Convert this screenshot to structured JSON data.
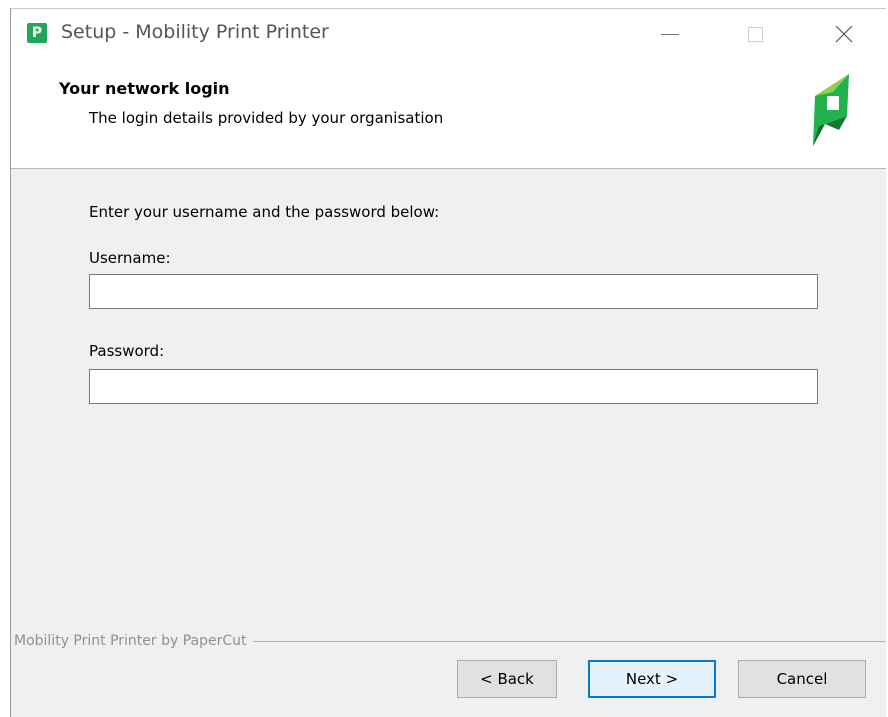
{
  "window": {
    "title": "Setup - Mobility Print Printer",
    "app_icon_letter": "P",
    "controls": {
      "minimize": "minimize",
      "maximize": "maximize",
      "close": "close"
    }
  },
  "header": {
    "title": "Your network login",
    "subtitle": "The login details provided by your organisation",
    "logo": "papercut-logo"
  },
  "form": {
    "instruction": "Enter your username and the password below:",
    "username_label": "Username:",
    "username_value": "",
    "password_label": "Password:",
    "password_value": ""
  },
  "footer": {
    "group_label": "Mobility Print Printer by PaperCut",
    "buttons": {
      "back": "< Back",
      "next": "Next >",
      "cancel": "Cancel"
    }
  },
  "colors": {
    "brand_green": "#1fa85a",
    "focus_blue": "#0078d7",
    "dialog_bg": "#f0f0f0"
  }
}
